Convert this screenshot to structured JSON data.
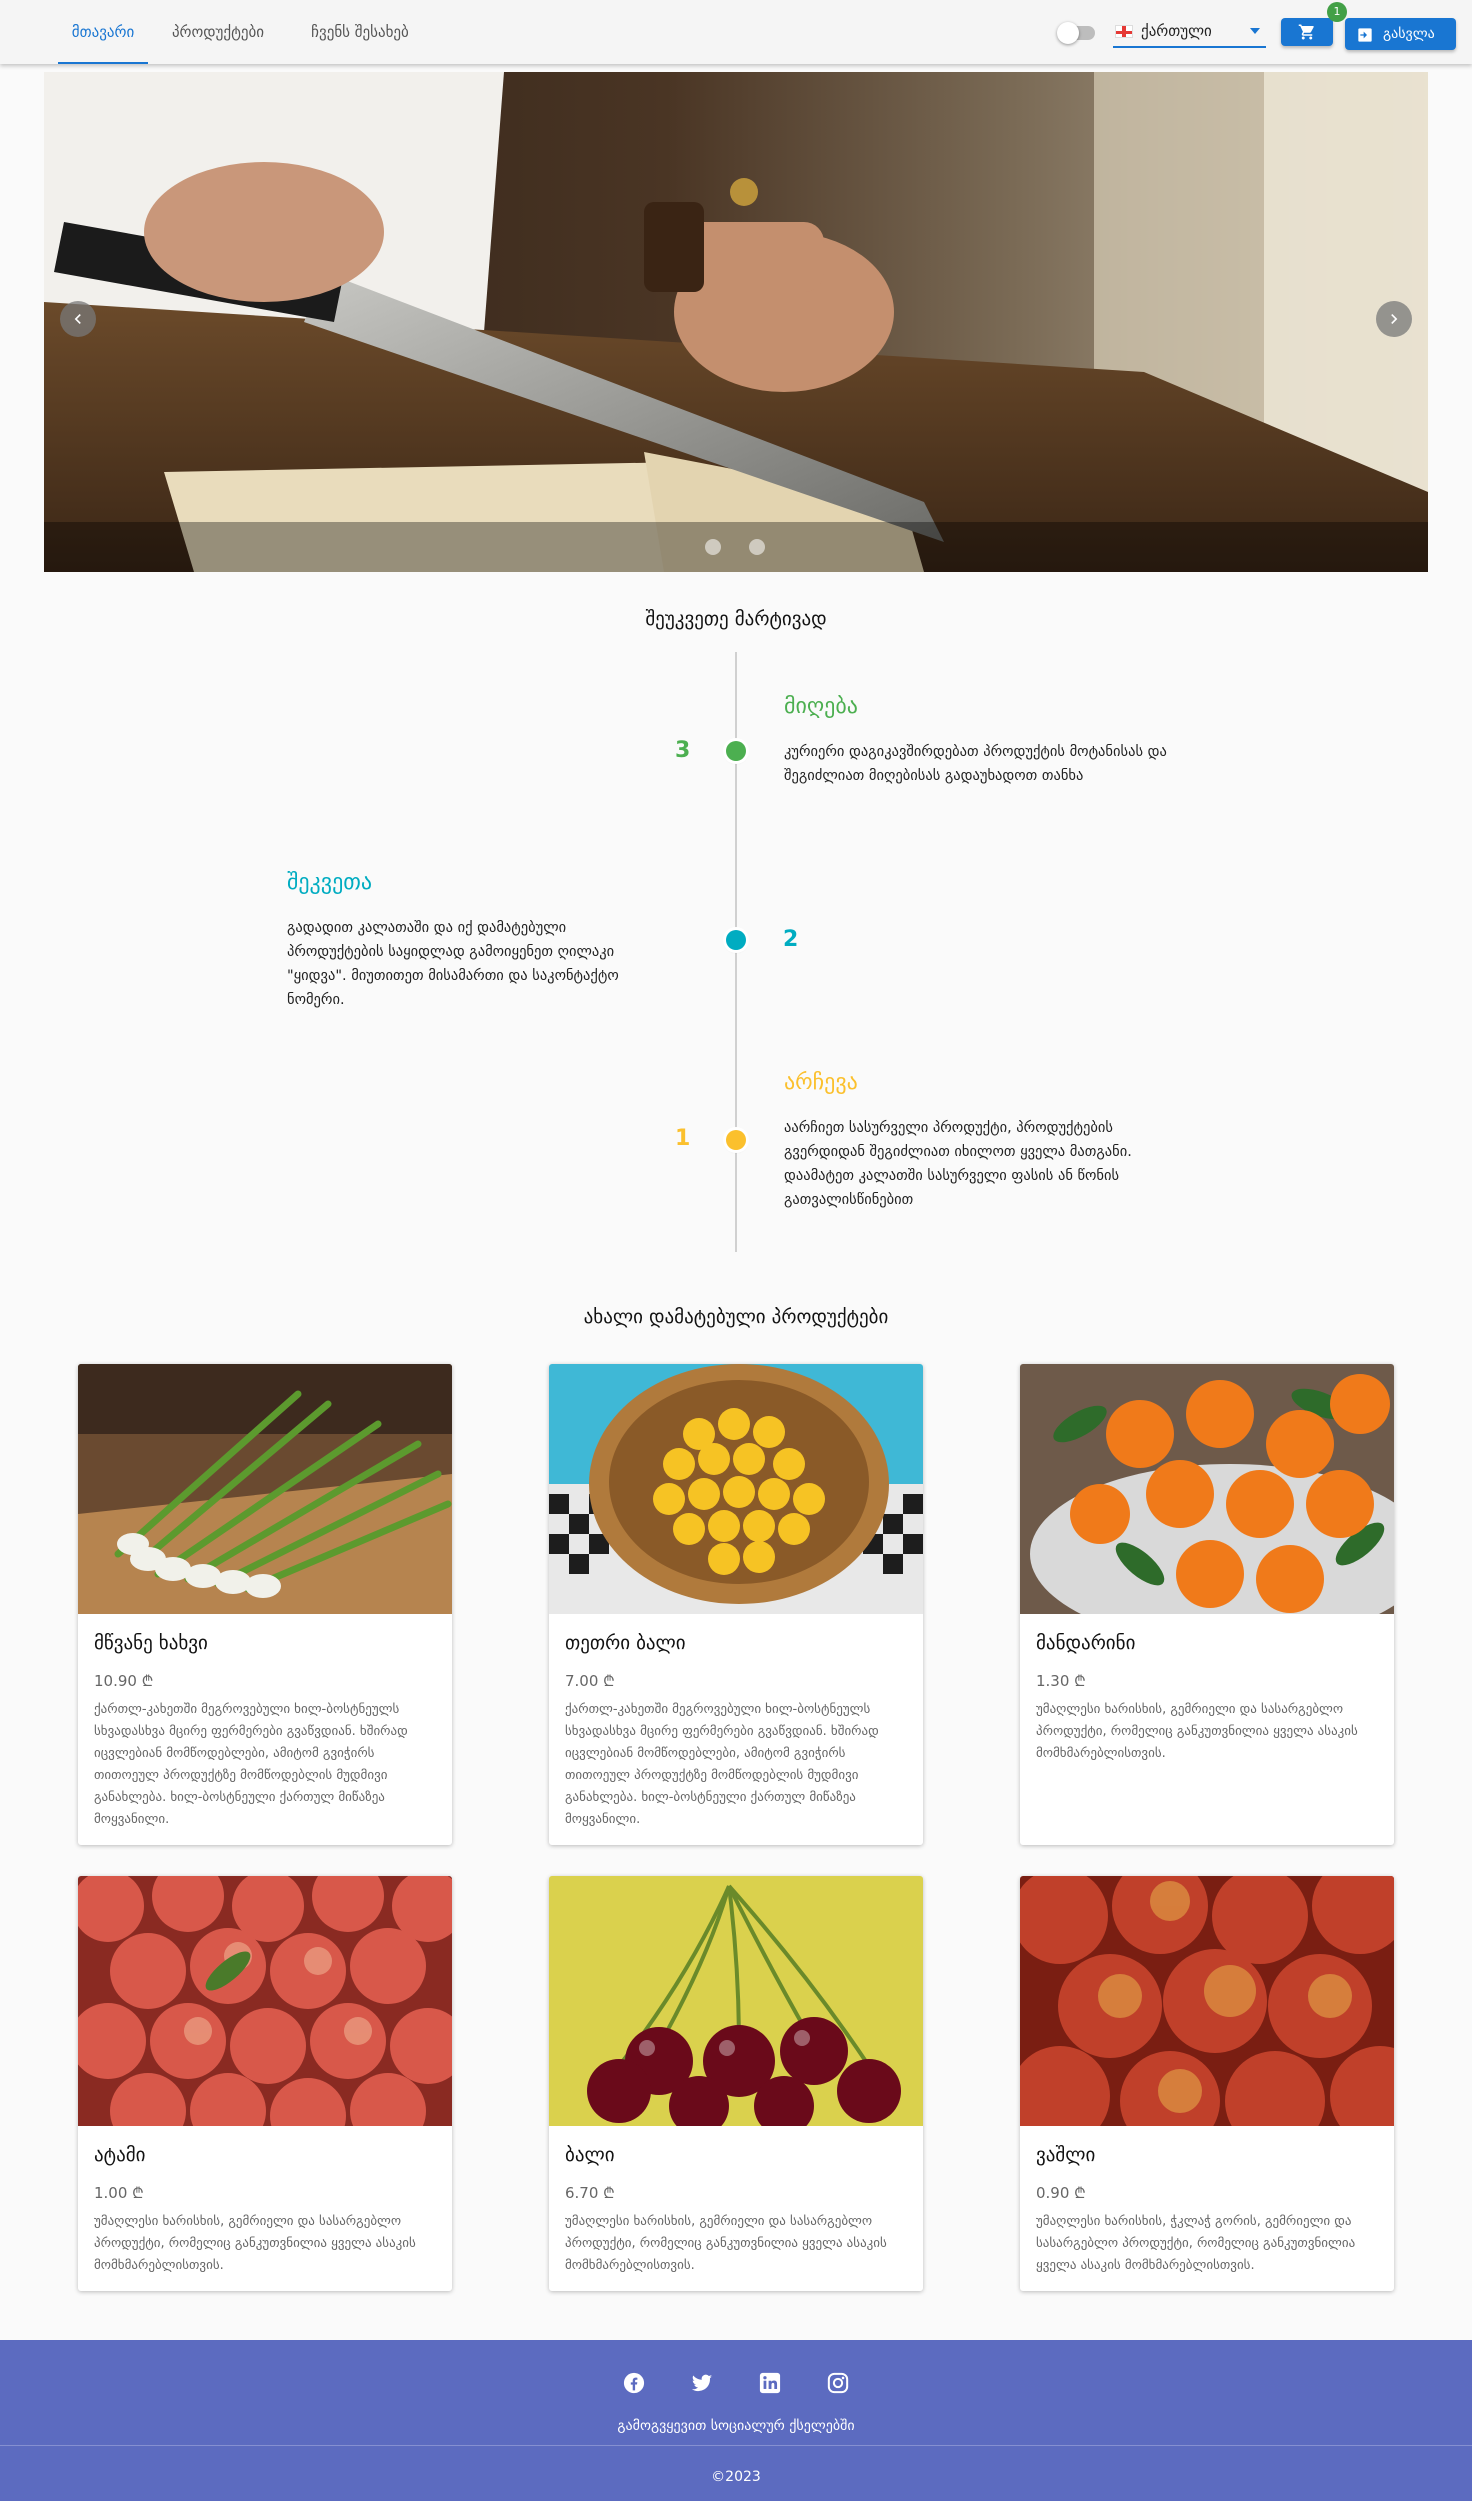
{
  "nav": {
    "tabs": [
      {
        "label": "მთავარი",
        "active": true
      },
      {
        "label": "პროდუქტები",
        "active": false
      },
      {
        "label": "ჩვენს შესახებ",
        "active": false
      }
    ],
    "theme_toggle": {
      "on": false
    },
    "language": {
      "label": "ქართული",
      "flag_icon": "georgia-flag-icon"
    },
    "cart": {
      "count": "1",
      "icon": "cart-icon"
    },
    "logout_label": "გასვლა",
    "logout_icon": "logout-icon",
    "accent_color": "#1976d2"
  },
  "carousel": {
    "slide_count": 2,
    "active_slide": 1,
    "prev_icon": "chevron-left-icon",
    "next_icon": "chevron-right-icon"
  },
  "how_to": {
    "title": "შეუკვეთე მარტივად",
    "steps": [
      {
        "number": "3",
        "title": "მიღება",
        "text": "კურიერი დაგიკავშირდებათ პროდუქტის მოტანისას და შეგიძლიათ მიღებისას გადაუხადოთ თანხა",
        "color": "#4caf50"
      },
      {
        "number": "2",
        "title": "შეკვეთა",
        "text": "გადადით კალათაში და იქ დამატებული პროდუქტების საყიდლად გამოიყენეთ ღილაკი \"ყიდვა\". მიუთითეთ მისამართი და საკონტაქტო ნომერი.",
        "color": "#00acc1"
      },
      {
        "number": "1",
        "title": "არჩევა",
        "text": "აარჩიეთ სასურველი პროდუქტი, პროდუქტების გვერდიდან შეგიძლიათ იხილოთ ყველა მათგანი. დაამატეთ კალათში სასურველი ფასის ან წონის გათვალისწინებით",
        "color": "#fbc02d"
      }
    ]
  },
  "products": {
    "title": "ახალი დამატებული პროდუქტები",
    "items": [
      {
        "name": "მწვანე ხახვი",
        "price": "10.90 ₾",
        "desc": "ქართლ-კახეთში მეგროვებული ხილ-ბოსტნეულს სხვადასხვა მცირე ფერმერები გვაწვდიან. ხშირად იცვლებიან მომწოდებლები, ამიტომ გვიჭირს თითოეულ პროდუქტზე მომწოდებლის მუდმივი განახლება. ხილ-ბოსტნეული ქართულ მიწაზეა მოყვანილი.",
        "image": "green-onions"
      },
      {
        "name": "თეთრი ბალი",
        "price": "7.00 ₾",
        "desc": "ქართლ-კახეთში მეგროვებული ხილ-ბოსტნეულს სხვადასხვა მცირე ფერმერები გვაწვდიან. ხშირად იცვლებიან მომწოდებლები, ამიტომ გვიჭირს თითოეულ პროდუქტზე მომწოდებლის მუდმივი განახლება. ხილ-ბოსტნეული ქართულ მიწაზეა მოყვანილი.",
        "image": "yellow-cherries"
      },
      {
        "name": "მანდარინი",
        "price": "1.30 ₾",
        "desc": "უმაღლესი ხარისხის, გემრიელი და სასარგებლო პროდუქტი, რომელიც განკუთვნილია ყველა ასაკის მომხმარებლისთვის.",
        "image": "mandarins"
      },
      {
        "name": "ატამი",
        "price": "1.00 ₾",
        "desc": "უმაღლესი ხარისხის, გემრიელი და სასარგებლო პროდუქტი, რომელიც განკუთვნილია ყველა ასაკის მომხმარებლისთვის.",
        "image": "peaches"
      },
      {
        "name": "ბალი",
        "price": "6.70 ₾",
        "desc": "უმაღლესი ხარისხის, გემრიელი და სასარგებლო პროდუქტი, რომელიც განკუთვნილია ყველა ასაკის მომხმარებლისთვის.",
        "image": "red-cherries"
      },
      {
        "name": "ვაშლი",
        "price": "0.90 ₾",
        "desc": "უმაღლესი ხარისხის, ჭკლაჭ გორის, გემრიელი და სასარგებლო პროდუქტი, რომელიც განკუთვნილია ყველა ასაკის მომხმარებლისთვის.",
        "image": "apples"
      }
    ]
  },
  "footer": {
    "social_icons": [
      "facebook-icon",
      "twitter-icon",
      "linkedin-icon",
      "instagram-icon"
    ],
    "text": "გამოგვყევით სოციალურ ქსელებში",
    "copyright": "©2023",
    "color": "#5c6bc0"
  }
}
